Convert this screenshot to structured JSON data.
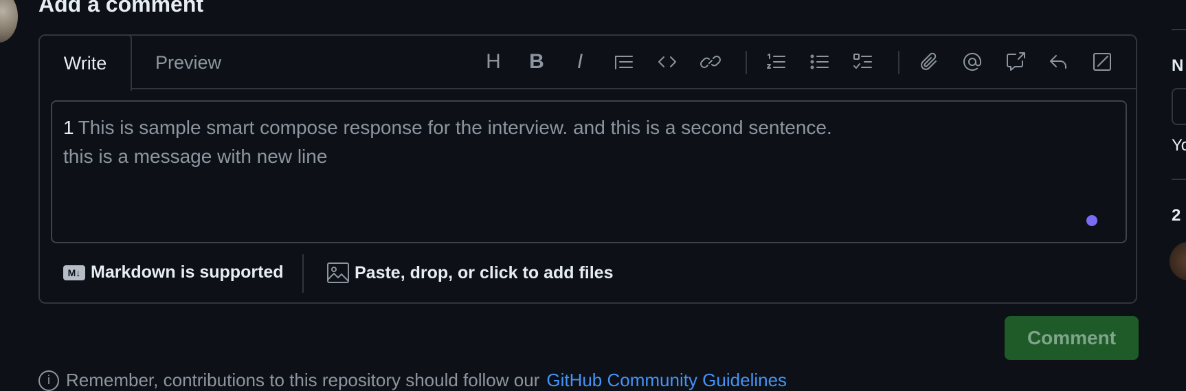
{
  "heading": "Add a comment",
  "tabs": {
    "write": "Write",
    "preview": "Preview"
  },
  "toolbar": {
    "heading_glyph": "H",
    "bold_glyph": "B",
    "italic_glyph": "I"
  },
  "editor": {
    "line_number": "1",
    "line1_text": "This is sample smart compose response for the interview. and this is a second sentence.",
    "line2_text": "this is a message with new line"
  },
  "footer": {
    "markdown_icon_text": "M↓",
    "markdown_label": "Markdown is supported",
    "files_label": "Paste, drop, or click to add files"
  },
  "comment_button": "Comment",
  "remember": {
    "text": "Remember, contributions to this repository should follow our",
    "link": "GitHub Community Guidelines"
  },
  "right_sidebar": {
    "label_n": "N",
    "label_yo": "Yo",
    "label_2": "2"
  },
  "colors": {
    "background": "#0d1117",
    "border": "#30363d",
    "muted_text": "#8d96a0",
    "comment_button_bg": "#1f5a29",
    "link": "#4493f8",
    "indicator_dot": "#7b6cf6"
  }
}
